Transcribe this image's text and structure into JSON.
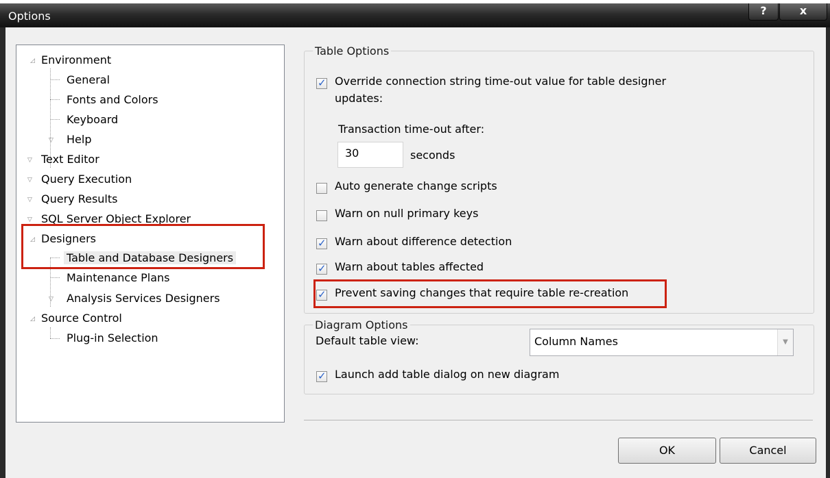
{
  "window": {
    "title": "Options",
    "help_label": "?",
    "close_label": "x"
  },
  "tree": [
    {
      "label": "Environment"
    },
    {
      "label": "General"
    },
    {
      "label": "Fonts and Colors"
    },
    {
      "label": "Keyboard"
    },
    {
      "label": "Help"
    },
    {
      "label": "Text Editor"
    },
    {
      "label": "Query Execution"
    },
    {
      "label": "Query Results"
    },
    {
      "label": "SQL Server Object Explorer"
    },
    {
      "label": "Designers"
    },
    {
      "label": "Table and Database Designers",
      "selected": true
    },
    {
      "label": "Maintenance Plans"
    },
    {
      "label": "Analysis Services Designers"
    },
    {
      "label": "Source Control"
    },
    {
      "label": "Plug-in Selection"
    }
  ],
  "table_options": {
    "legend": "Table Options",
    "override_label_line1": "Override connection string time-out value for table designer",
    "override_label_line2": "updates:",
    "override_checked": true,
    "timeout_label": "Transaction time-out after:",
    "timeout_value": "30",
    "timeout_unit": "seconds",
    "auto_generate_label": "Auto generate change scripts",
    "auto_generate_checked": false,
    "warn_null_label": "Warn on null primary keys",
    "warn_null_checked": false,
    "warn_diff_label": "Warn about difference detection",
    "warn_diff_checked": true,
    "warn_tables_label": "Warn about tables affected",
    "warn_tables_checked": true,
    "prevent_saving_label": "Prevent saving changes that require table re-creation",
    "prevent_saving_checked": true
  },
  "diagram_options": {
    "legend": "Diagram Options",
    "default_view_label": "Default table view:",
    "default_view_value": "Column Names",
    "launch_add_label": "Launch add table dialog on new diagram",
    "launch_add_checked": true
  },
  "buttons": {
    "ok": "OK",
    "cancel": "Cancel"
  },
  "colors": {
    "highlight": "#cc2211",
    "check": "#2a62c8"
  }
}
